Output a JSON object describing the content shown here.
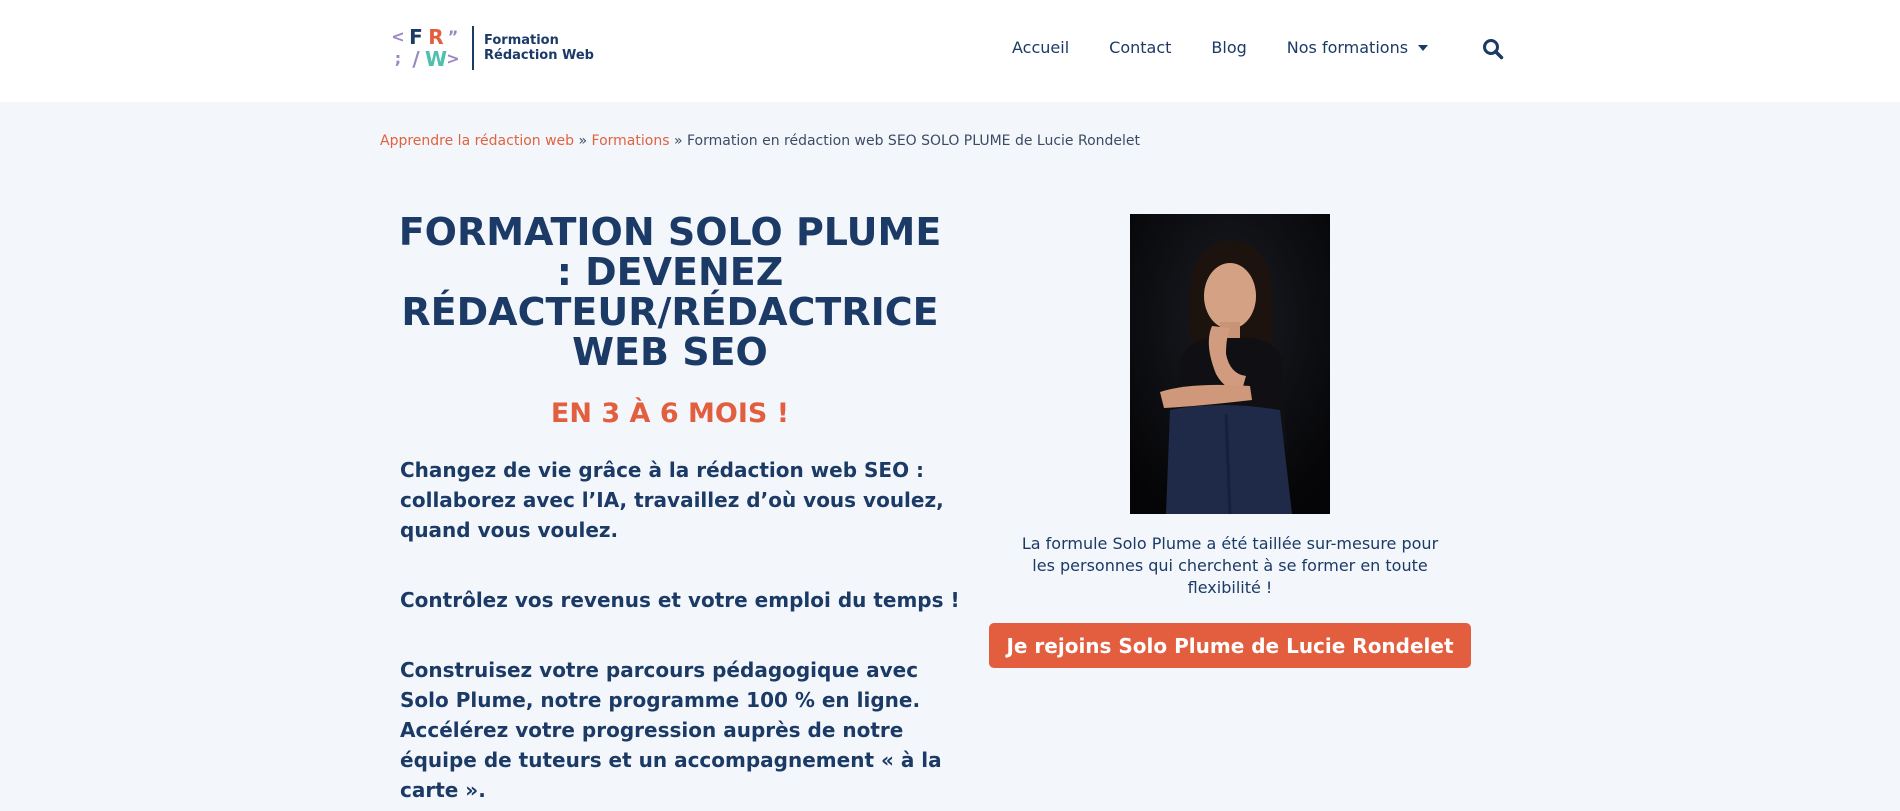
{
  "colors": {
    "brand_navy": "#1b3a66",
    "accent_orange": "#e35d3f",
    "logo_purple": "#9b86c4",
    "logo_teal": "#4fbfae",
    "page_background": "#f3f7fc"
  },
  "header": {
    "logo": {
      "marks": [
        "<",
        "F",
        "R",
        "”",
        ";",
        "/",
        "W",
        ">"
      ],
      "text_line1": "Formation",
      "text_line2": "Rédaction Web"
    },
    "nav": [
      {
        "label": "Accueil"
      },
      {
        "label": "Contact"
      },
      {
        "label": "Blog"
      },
      {
        "label": "Nos formations",
        "has_dropdown": true
      }
    ],
    "search_icon": "search-icon"
  },
  "breadcrumb": {
    "items": [
      "Apprendre la rédaction web",
      "Formations"
    ],
    "separator": "»",
    "current": "Formation en rédaction web SEO SOLO PLUME de Lucie Rondelet"
  },
  "main": {
    "title": "FORMATION SOLO PLUME : DEVENEZ RÉDACTEUR/RÉDACTRICE WEB SEO",
    "subtitle": "EN 3 À 6 MOIS !",
    "paragraphs": [
      "Changez de vie grâce à la rédaction web SEO : collaborez avec l’IA, travaillez d’où vous voulez, quand vous voulez.",
      "Contrôlez vos revenus et votre emploi du temps !",
      "Construisez votre parcours pédagogique avec Solo Plume, notre programme 100 % en ligne. Accélérez votre progression auprès de notre équipe de tuteurs et un accompagnement « à la carte »."
    ]
  },
  "aside": {
    "caption": "La formule Solo Plume a été taillée sur-mesure pour les personnes qui cherchent à se former en toute flexibilité !",
    "cta_label": "Je rejoins Solo Plume de Lucie Rondelet"
  }
}
